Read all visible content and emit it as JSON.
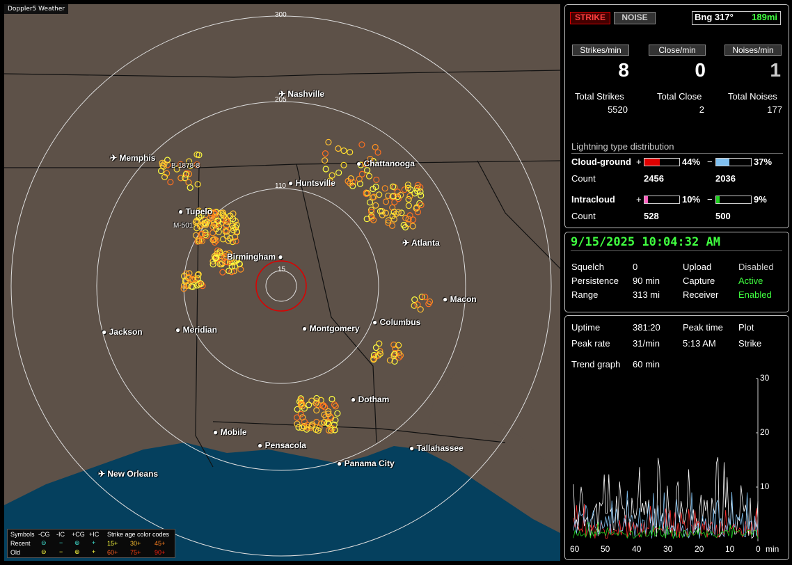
{
  "app": {
    "title": "Doppler5 Weather"
  },
  "map": {
    "range_labels": [
      "300",
      "205",
      "110",
      "15"
    ],
    "cities": [
      "Nashville",
      "Memphis",
      "Chattanooga",
      "Huntsville",
      "Tupelo",
      "Atlanta",
      "Birmingham",
      "Macon",
      "Jackson",
      "Meridian",
      "Montgomery",
      "Columbus",
      "Dotham",
      "Mobile",
      "Pensacola",
      "Tallahassee",
      "Panama City",
      "New Orleans"
    ],
    "markers": [
      "B-1878-8",
      "M-501"
    ]
  },
  "legend": {
    "symbols_label": "Symbols",
    "neg_cg": "-CG",
    "neg_ic": "-IC",
    "pos_cg": "+CG",
    "pos_ic": "+IC",
    "age_title": "Strike age color codes",
    "recent": "Recent",
    "old": "Old",
    "ages": [
      "15+",
      "30+",
      "45+",
      "60+",
      "75+",
      "90+"
    ],
    "age_colors": [
      "#ffff40",
      "#ffc030",
      "#ff8020",
      "#ff6020",
      "#ff4010",
      "#ff2010"
    ]
  },
  "top": {
    "strike_btn": "STRIKE",
    "noise_btn": "NOISE",
    "bearing": "Bng 317°",
    "distance": "189mi",
    "strikes_min_label": "Strikes/min",
    "close_min_label": "Close/min",
    "noises_min_label": "Noises/min",
    "strikes_min": "8",
    "close_min": "0",
    "noises_min": "1",
    "total_strikes_label": "Total Strikes",
    "total_close_label": "Total Close",
    "total_noises_label": "Total Noises",
    "total_strikes": "5520",
    "total_close": "2",
    "total_noises": "177",
    "dist_title": "Lightning type distribution",
    "cg_label": "Cloud-ground",
    "ic_label": "Intracloud",
    "count_label": "Count",
    "plus": "+",
    "minus": "−",
    "cg_pos_pct": "44%",
    "cg_neg_pct": "37%",
    "cg_pos_count": "2456",
    "cg_neg_count": "2036",
    "ic_pos_pct": "10%",
    "ic_neg_pct": "9%",
    "ic_pos_count": "528",
    "ic_neg_count": "500",
    "cg_pos_fill": 0.44,
    "cg_neg_fill": 0.37,
    "ic_pos_fill": 0.1,
    "ic_neg_fill": 0.09
  },
  "status": {
    "datetime": "9/15/2025 10:04:32 AM",
    "squelch_label": "Squelch",
    "squelch": "0",
    "persistence_label": "Persistence",
    "persistence": "90 min",
    "range_label": "Range",
    "range": "313 mi",
    "upload_label": "Upload",
    "upload": "Disabled",
    "capture_label": "Capture",
    "capture": "Active",
    "receiver_label": "Receiver",
    "receiver": "Enabled"
  },
  "trend": {
    "uptime_label": "Uptime",
    "uptime": "381:20",
    "peak_time_label": "Peak time",
    "peak_time": "5:13 AM",
    "plot_label": "Plot",
    "plot": "Strike",
    "peak_rate_label": "Peak rate",
    "peak_rate": "31/min",
    "trend_label": "Trend graph",
    "trend": "60 min",
    "y_ticks": [
      "30",
      "20",
      "10"
    ],
    "x_ticks": [
      "60",
      "50",
      "40",
      "30",
      "20",
      "10",
      "0"
    ],
    "x_unit": "min"
  }
}
